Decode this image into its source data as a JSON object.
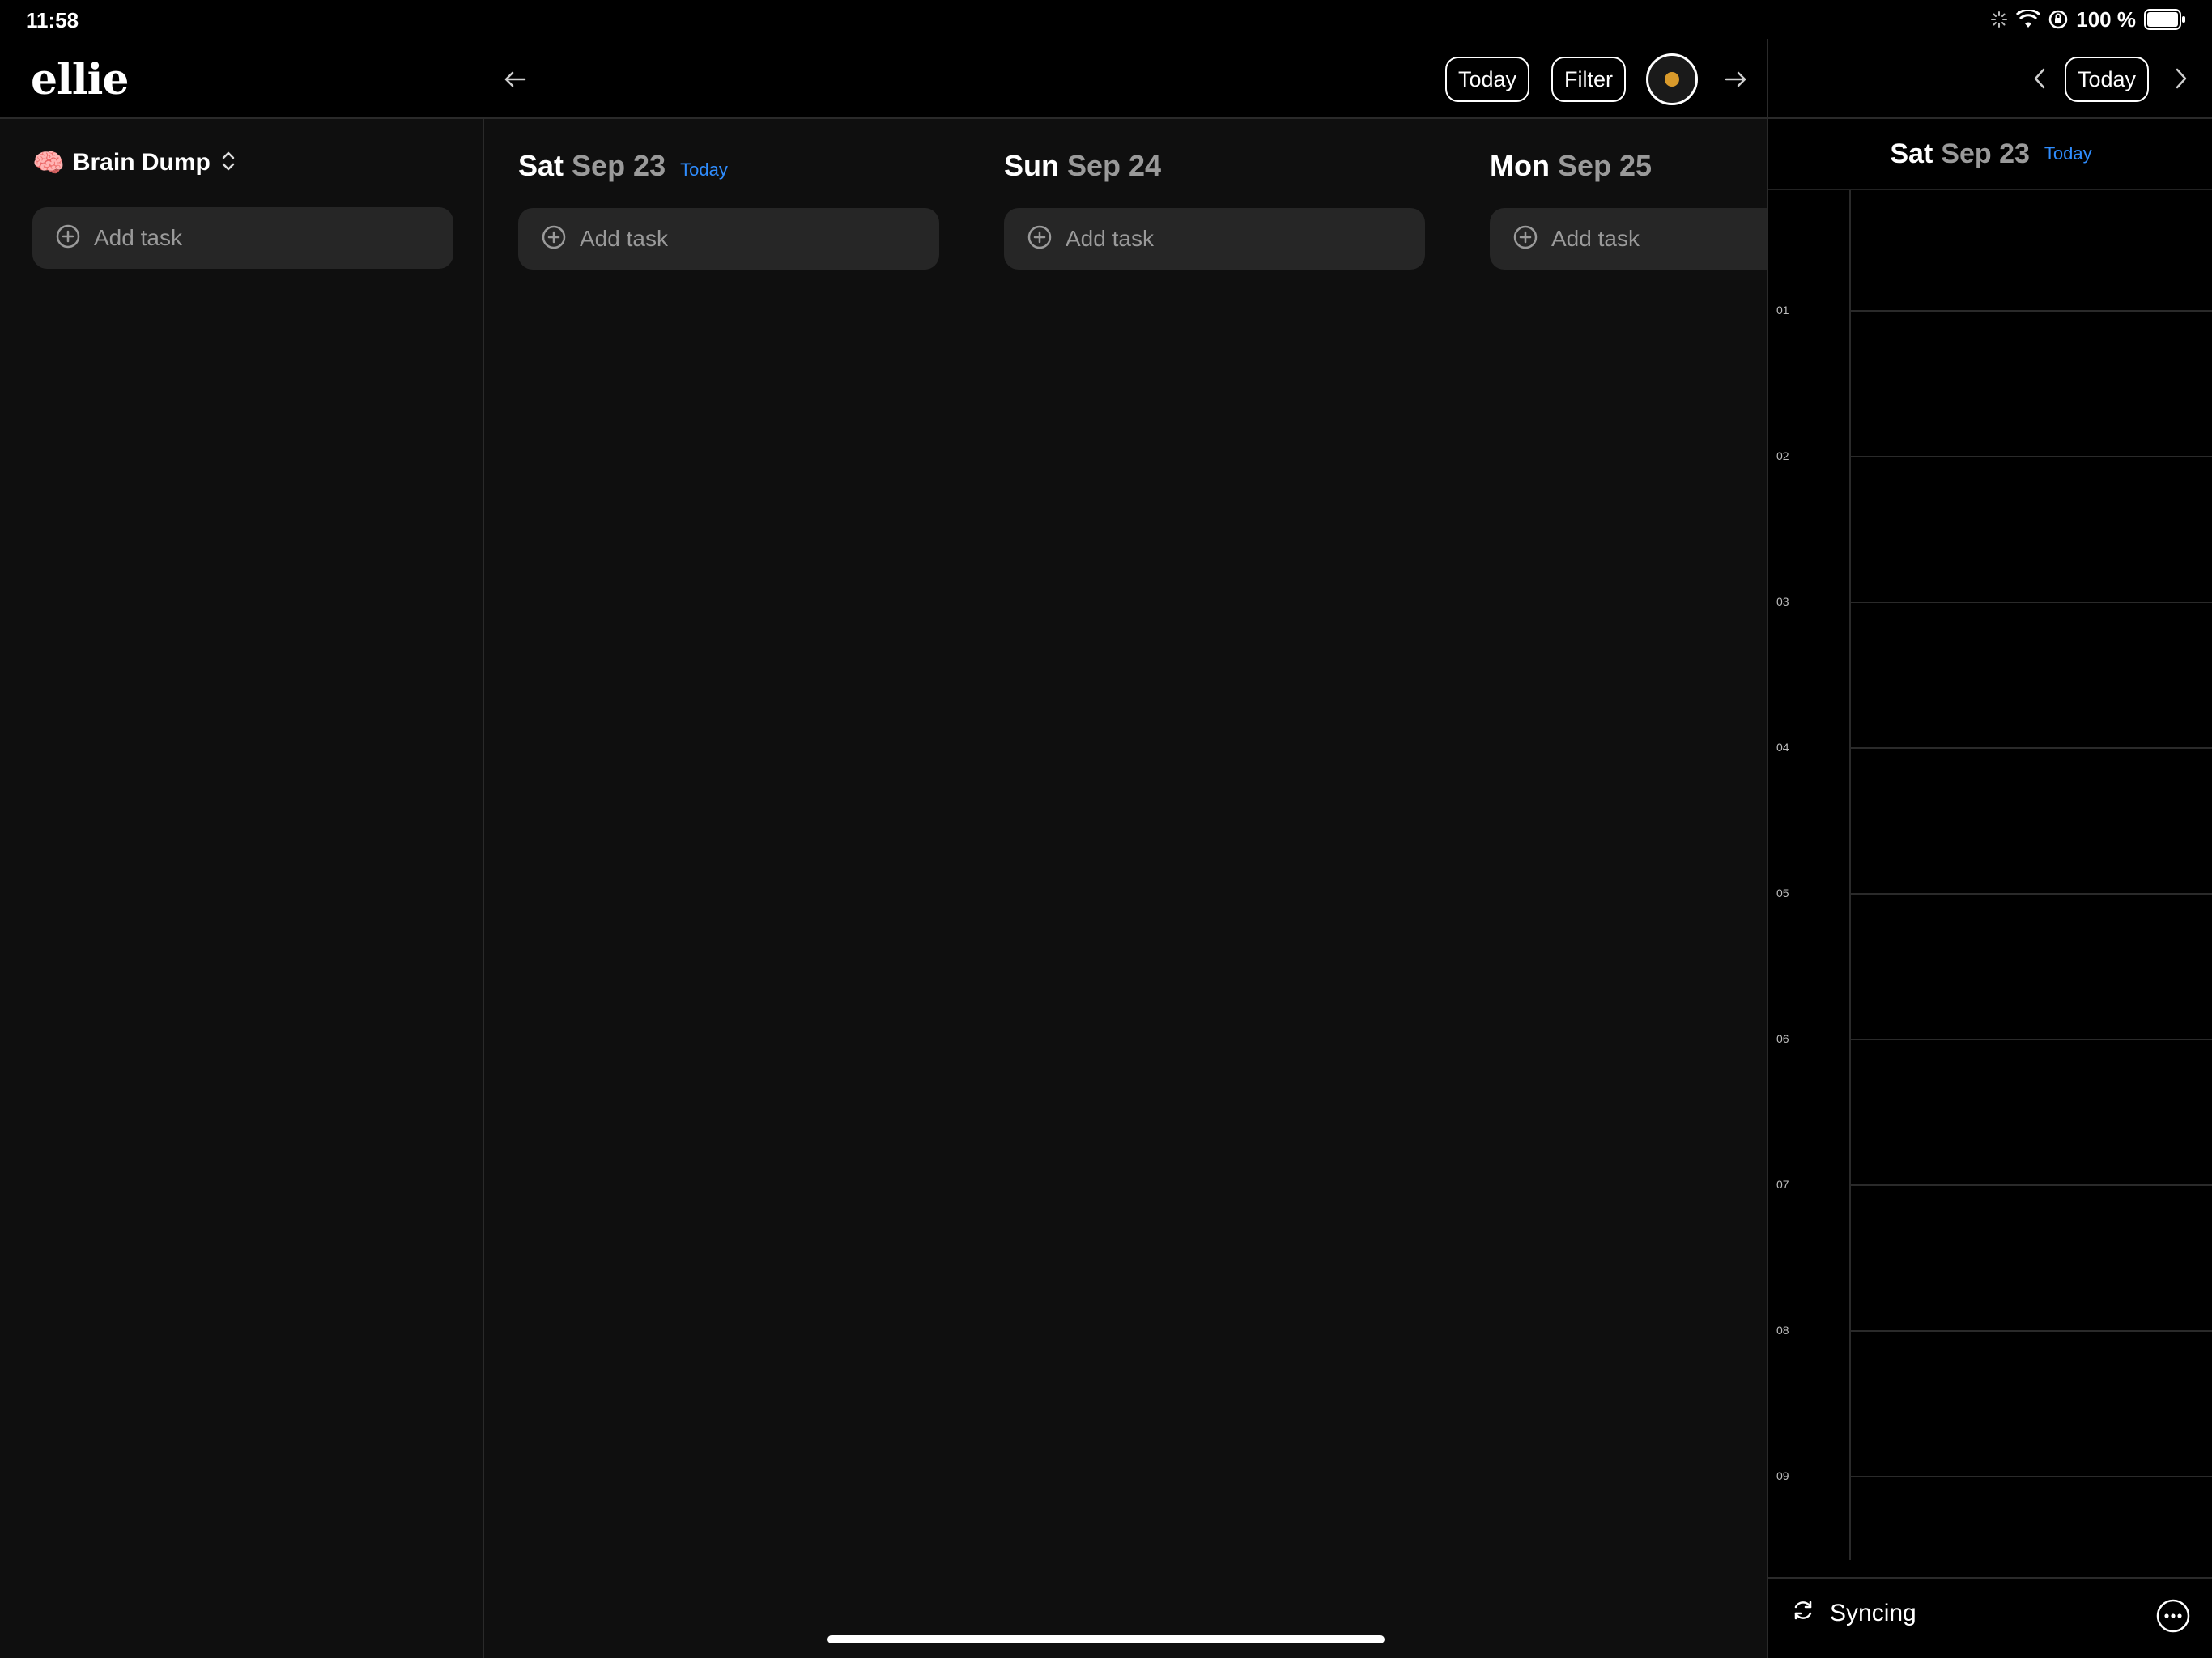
{
  "status_bar": {
    "time": "11:58",
    "battery_text": "100 %"
  },
  "app": {
    "logo": "ellie"
  },
  "left_panel": {
    "list_emoji": "🧠",
    "list_title": "Brain Dump",
    "add_task_label": "Add task"
  },
  "toolbar": {
    "today_label": "Today",
    "filter_label": "Filter"
  },
  "days": [
    {
      "name": "Sat",
      "date": "Sep 23",
      "badge": "Today",
      "add_task_label": "Add task"
    },
    {
      "name": "Sun",
      "date": "Sep 24",
      "badge": "",
      "add_task_label": "Add task"
    },
    {
      "name": "Mon",
      "date": "Sep 25",
      "badge": "",
      "add_task_label": "Add task"
    }
  ],
  "calendar": {
    "today_label": "Today",
    "day_name": "Sat",
    "day_date": "Sep 23",
    "badge": "Today",
    "hours": [
      "01",
      "02",
      "03",
      "04",
      "05",
      "06",
      "07",
      "08",
      "09"
    ],
    "sync_label": "Syncing"
  },
  "colors": {
    "accent_blue": "#2f8dff",
    "background": "#0f0f0f",
    "header": "#000000",
    "card": "#262626"
  }
}
